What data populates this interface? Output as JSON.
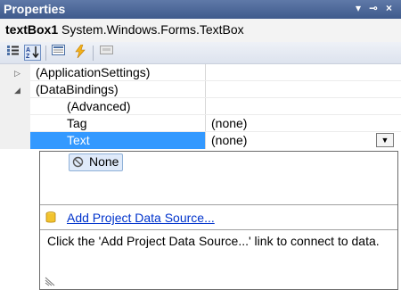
{
  "window": {
    "title": "Properties",
    "pin_glyph": "▾",
    "pushpin_glyph": "⊸",
    "close_glyph": "×"
  },
  "object": {
    "name": "textBox1",
    "type": "System.Windows.Forms.TextBox"
  },
  "toolbar": {
    "categorized_icon": "categorized-icon",
    "alphabetical_icon": "alphabetical-icon",
    "properties_icon": "properties-icon",
    "events_icon": "events-icon",
    "property_pages_icon": "property-pages-icon",
    "categorized_glyph": "▦",
    "alphabetical_glyph": "A↓",
    "properties_glyph": "▤",
    "events_glyph": "⚡",
    "pages_glyph": "▭"
  },
  "grid": {
    "rows": [
      {
        "name": "(ApplicationSettings)",
        "value": "",
        "expander": "▷"
      },
      {
        "name": "(DataBindings)",
        "value": "",
        "expander": "◢"
      },
      {
        "name": "(Advanced)",
        "value": ""
      },
      {
        "name": "Tag",
        "value": "(none)"
      },
      {
        "name": "Text",
        "value": "(none)",
        "dropdown_glyph": "▼"
      }
    ]
  },
  "dropdown": {
    "none_label": "None",
    "link_label": "Add Project Data Source...",
    "help_text": "Click the 'Add Project Data Source...' link to connect to data."
  },
  "colors": {
    "title_bar": "#4a6597",
    "selection": "#3399ff",
    "link": "#0033cc"
  }
}
